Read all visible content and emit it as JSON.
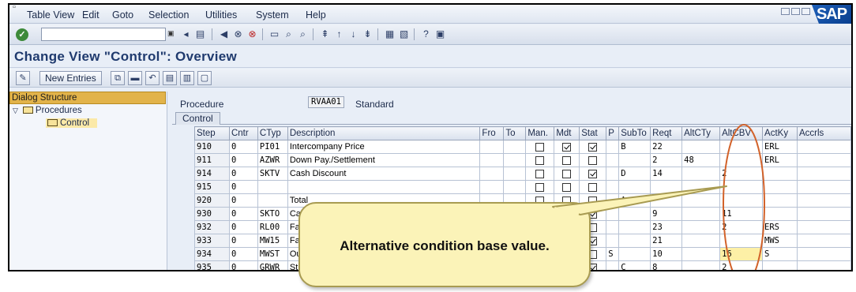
{
  "menu": [
    {
      "label": "Table View"
    },
    {
      "label": "Edit"
    },
    {
      "label": "Goto"
    },
    {
      "label": "Selection"
    },
    {
      "label": "Utilities"
    },
    {
      "label": "System"
    },
    {
      "label": "Help"
    }
  ],
  "logo": "SAP",
  "title": "Change View \"Control\": Overview",
  "app_toolbar": {
    "new_entries": "New Entries"
  },
  "tree": {
    "header": "Dialog Structure",
    "items": [
      {
        "label": "Procedures"
      },
      {
        "label": "Control"
      }
    ]
  },
  "procedure": {
    "label": "Procedure",
    "value": "RVAA01",
    "text": "Standard"
  },
  "tab": "Control",
  "table": {
    "columns": [
      "Step",
      "Cntr",
      "CTyp",
      "Description",
      "Fro",
      "To",
      "Man.",
      "Mdt",
      "Stat",
      "P",
      "SubTo",
      "Reqt",
      "AltCTy",
      "AltCBV",
      "ActKy",
      "Accrls"
    ],
    "rows": [
      {
        "step": "910",
        "cntr": "0",
        "ctyp": "PI01",
        "desc": "Intercompany Price",
        "man": false,
        "mdt": true,
        "stat": true,
        "p": "",
        "subto": "B",
        "reqt": "22",
        "altcty": "",
        "altcbv": "",
        "actky": "ERL"
      },
      {
        "step": "911",
        "cntr": "0",
        "ctyp": "AZWR",
        "desc": "Down Pay./Settlement",
        "man": false,
        "mdt": false,
        "stat": false,
        "p": "",
        "subto": "",
        "reqt": "2",
        "altcty": "48",
        "altcbv": "",
        "actky": "ERL"
      },
      {
        "step": "914",
        "cntr": "0",
        "ctyp": "SKTV",
        "desc": "Cash Discount",
        "man": false,
        "mdt": false,
        "stat": true,
        "p": "",
        "subto": "D",
        "reqt": "14",
        "altcty": "",
        "altcbv": "2",
        "actky": ""
      },
      {
        "step": "915",
        "cntr": "0",
        "ctyp": "",
        "desc": "",
        "man": false,
        "mdt": false,
        "stat": false,
        "p": "",
        "subto": "",
        "reqt": "",
        "altcty": "",
        "altcbv": "",
        "actky": ""
      },
      {
        "step": "920",
        "cntr": "0",
        "ctyp": "",
        "desc": "Total",
        "man": false,
        "mdt": false,
        "stat": false,
        "p": "",
        "subto": "A",
        "reqt": "",
        "altcty": "",
        "altcbv": "",
        "actky": ""
      },
      {
        "step": "930",
        "cntr": "0",
        "ctyp": "SKTO",
        "desc": "Ca",
        "man": false,
        "mdt": false,
        "stat": true,
        "p": "",
        "subto": "",
        "reqt": "9",
        "altcty": "",
        "altcbv": "11",
        "actky": ""
      },
      {
        "step": "932",
        "cntr": "0",
        "ctyp": "RL00",
        "desc": "Fa",
        "man": false,
        "mdt": false,
        "stat": false,
        "p": "",
        "subto": "",
        "reqt": "23",
        "altcty": "",
        "altcbv": "2",
        "actky": "ERS"
      },
      {
        "step": "933",
        "cntr": "0",
        "ctyp": "MW15",
        "desc": "Fa",
        "man": false,
        "mdt": false,
        "stat": true,
        "p": "",
        "subto": "",
        "reqt": "21",
        "altcty": "",
        "altcbv": "",
        "actky": "MWS"
      },
      {
        "step": "934",
        "cntr": "0",
        "ctyp": "MWST",
        "desc": "Ou",
        "man": false,
        "mdt": false,
        "stat": false,
        "p": "S",
        "subto": "",
        "reqt": "10",
        "altcty": "",
        "altcbv": "16",
        "actky": "S"
      },
      {
        "step": "935",
        "cntr": "0",
        "ctyp": "GRWR",
        "desc": "St",
        "man": false,
        "mdt": false,
        "stat": true,
        "p": "",
        "subto": "C",
        "reqt": "8",
        "altcty": "",
        "altcbv": "2",
        "actky": ""
      }
    ]
  },
  "callout": {
    "text": "Alternative condition base value."
  },
  "colors": {
    "accent": "#1f3a6e",
    "tree_header": "#e2b34a",
    "callout_fill": "#fbf3b8",
    "annotation": "#d2622a"
  }
}
